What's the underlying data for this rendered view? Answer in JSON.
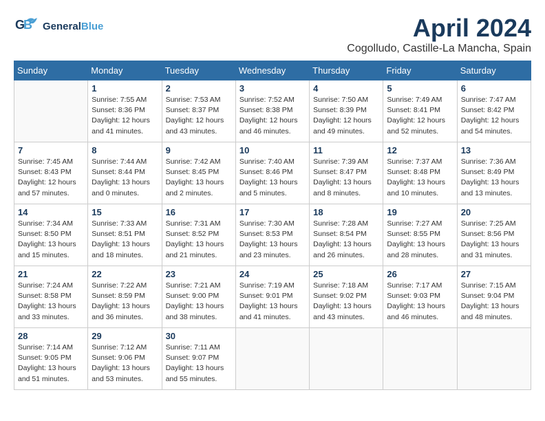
{
  "logo": {
    "part1": "General",
    "part2": "Blue"
  },
  "title": "April 2024",
  "subtitle": "Cogolludo, Castille-La Mancha, Spain",
  "headers": [
    "Sunday",
    "Monday",
    "Tuesday",
    "Wednesday",
    "Thursday",
    "Friday",
    "Saturday"
  ],
  "weeks": [
    [
      {
        "day": "",
        "info": ""
      },
      {
        "day": "1",
        "info": "Sunrise: 7:55 AM\nSunset: 8:36 PM\nDaylight: 12 hours\nand 41 minutes."
      },
      {
        "day": "2",
        "info": "Sunrise: 7:53 AM\nSunset: 8:37 PM\nDaylight: 12 hours\nand 43 minutes."
      },
      {
        "day": "3",
        "info": "Sunrise: 7:52 AM\nSunset: 8:38 PM\nDaylight: 12 hours\nand 46 minutes."
      },
      {
        "day": "4",
        "info": "Sunrise: 7:50 AM\nSunset: 8:39 PM\nDaylight: 12 hours\nand 49 minutes."
      },
      {
        "day": "5",
        "info": "Sunrise: 7:49 AM\nSunset: 8:41 PM\nDaylight: 12 hours\nand 52 minutes."
      },
      {
        "day": "6",
        "info": "Sunrise: 7:47 AM\nSunset: 8:42 PM\nDaylight: 12 hours\nand 54 minutes."
      }
    ],
    [
      {
        "day": "7",
        "info": "Sunrise: 7:45 AM\nSunset: 8:43 PM\nDaylight: 12 hours\nand 57 minutes."
      },
      {
        "day": "8",
        "info": "Sunrise: 7:44 AM\nSunset: 8:44 PM\nDaylight: 13 hours\nand 0 minutes."
      },
      {
        "day": "9",
        "info": "Sunrise: 7:42 AM\nSunset: 8:45 PM\nDaylight: 13 hours\nand 2 minutes."
      },
      {
        "day": "10",
        "info": "Sunrise: 7:40 AM\nSunset: 8:46 PM\nDaylight: 13 hours\nand 5 minutes."
      },
      {
        "day": "11",
        "info": "Sunrise: 7:39 AM\nSunset: 8:47 PM\nDaylight: 13 hours\nand 8 minutes."
      },
      {
        "day": "12",
        "info": "Sunrise: 7:37 AM\nSunset: 8:48 PM\nDaylight: 13 hours\nand 10 minutes."
      },
      {
        "day": "13",
        "info": "Sunrise: 7:36 AM\nSunset: 8:49 PM\nDaylight: 13 hours\nand 13 minutes."
      }
    ],
    [
      {
        "day": "14",
        "info": "Sunrise: 7:34 AM\nSunset: 8:50 PM\nDaylight: 13 hours\nand 15 minutes."
      },
      {
        "day": "15",
        "info": "Sunrise: 7:33 AM\nSunset: 8:51 PM\nDaylight: 13 hours\nand 18 minutes."
      },
      {
        "day": "16",
        "info": "Sunrise: 7:31 AM\nSunset: 8:52 PM\nDaylight: 13 hours\nand 21 minutes."
      },
      {
        "day": "17",
        "info": "Sunrise: 7:30 AM\nSunset: 8:53 PM\nDaylight: 13 hours\nand 23 minutes."
      },
      {
        "day": "18",
        "info": "Sunrise: 7:28 AM\nSunset: 8:54 PM\nDaylight: 13 hours\nand 26 minutes."
      },
      {
        "day": "19",
        "info": "Sunrise: 7:27 AM\nSunset: 8:55 PM\nDaylight: 13 hours\nand 28 minutes."
      },
      {
        "day": "20",
        "info": "Sunrise: 7:25 AM\nSunset: 8:56 PM\nDaylight: 13 hours\nand 31 minutes."
      }
    ],
    [
      {
        "day": "21",
        "info": "Sunrise: 7:24 AM\nSunset: 8:58 PM\nDaylight: 13 hours\nand 33 minutes."
      },
      {
        "day": "22",
        "info": "Sunrise: 7:22 AM\nSunset: 8:59 PM\nDaylight: 13 hours\nand 36 minutes."
      },
      {
        "day": "23",
        "info": "Sunrise: 7:21 AM\nSunset: 9:00 PM\nDaylight: 13 hours\nand 38 minutes."
      },
      {
        "day": "24",
        "info": "Sunrise: 7:19 AM\nSunset: 9:01 PM\nDaylight: 13 hours\nand 41 minutes."
      },
      {
        "day": "25",
        "info": "Sunrise: 7:18 AM\nSunset: 9:02 PM\nDaylight: 13 hours\nand 43 minutes."
      },
      {
        "day": "26",
        "info": "Sunrise: 7:17 AM\nSunset: 9:03 PM\nDaylight: 13 hours\nand 46 minutes."
      },
      {
        "day": "27",
        "info": "Sunrise: 7:15 AM\nSunset: 9:04 PM\nDaylight: 13 hours\nand 48 minutes."
      }
    ],
    [
      {
        "day": "28",
        "info": "Sunrise: 7:14 AM\nSunset: 9:05 PM\nDaylight: 13 hours\nand 51 minutes."
      },
      {
        "day": "29",
        "info": "Sunrise: 7:12 AM\nSunset: 9:06 PM\nDaylight: 13 hours\nand 53 minutes."
      },
      {
        "day": "30",
        "info": "Sunrise: 7:11 AM\nSunset: 9:07 PM\nDaylight: 13 hours\nand 55 minutes."
      },
      {
        "day": "",
        "info": ""
      },
      {
        "day": "",
        "info": ""
      },
      {
        "day": "",
        "info": ""
      },
      {
        "day": "",
        "info": ""
      }
    ]
  ]
}
